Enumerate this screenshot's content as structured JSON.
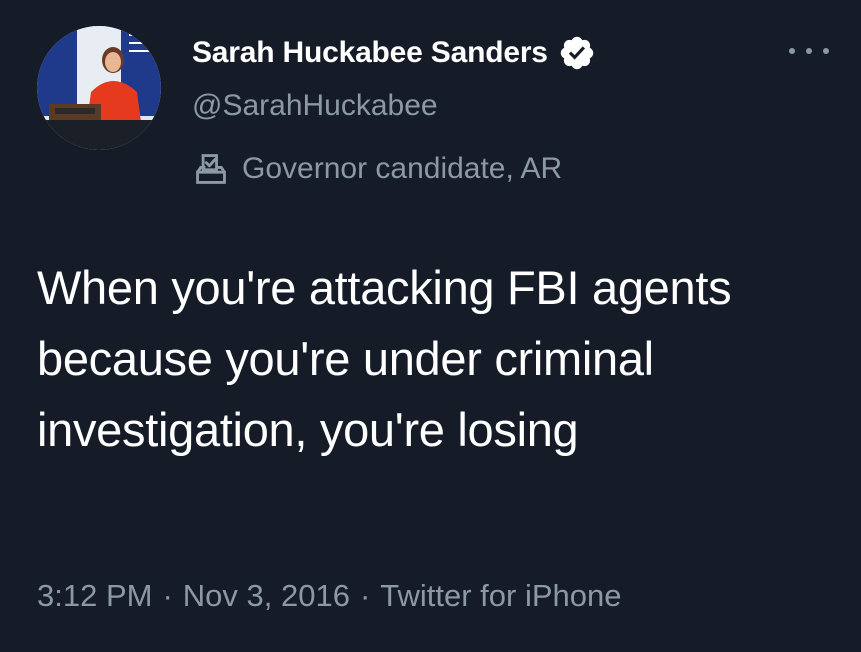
{
  "author": {
    "display_name": "Sarah Huckabee Sanders",
    "handle": "@SarahHuckabee",
    "verified_icon": "verified-badge-icon",
    "label": "Governor candidate, AR",
    "label_icon": "ballot-box-icon"
  },
  "tweet": {
    "text": "When you're attacking FBI agents because you're under criminal investigation, you're losing"
  },
  "meta": {
    "time": "3:12 PM",
    "separator": "·",
    "date": "Nov 3, 2016",
    "source": "Twitter for iPhone"
  },
  "menu": {
    "icon": "more-options-icon"
  },
  "colors": {
    "background": "#151c28",
    "primary_text": "#ffffff",
    "secondary_text": "#8b98a5"
  }
}
